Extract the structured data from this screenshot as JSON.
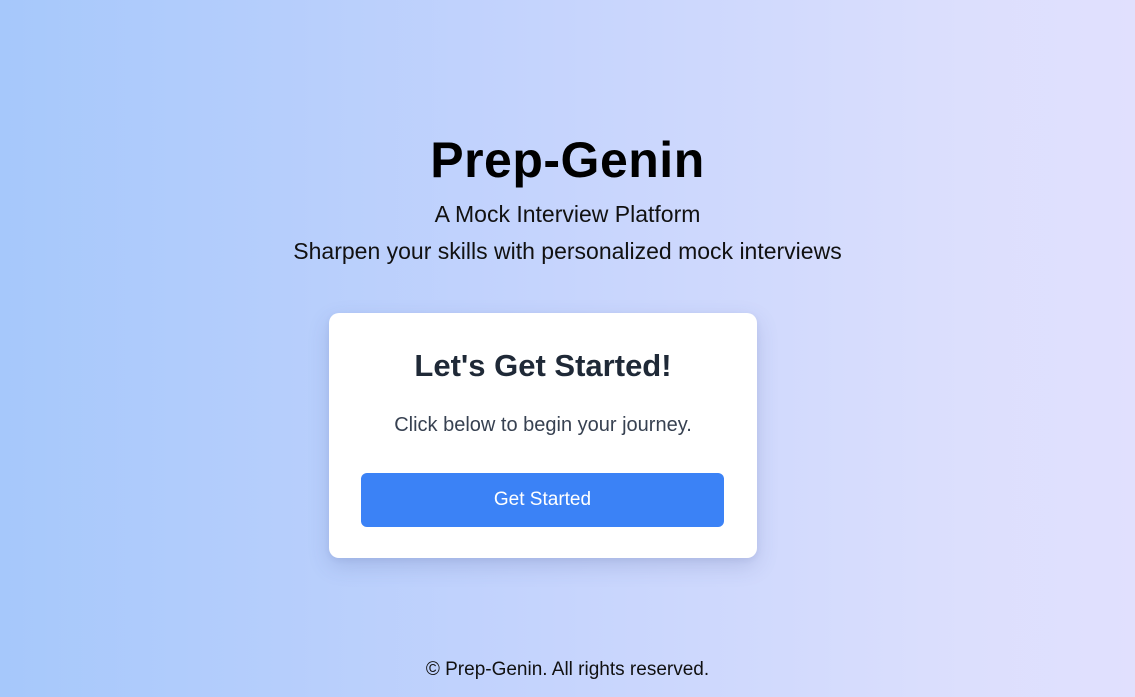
{
  "hero": {
    "title": "Prep-Genin",
    "tagline": "A Mock Interview Platform",
    "subtagline": "Sharpen your skills with personalized mock interviews"
  },
  "card": {
    "title": "Let's Get Started!",
    "text": "Click below to begin your journey.",
    "button_label": "Get Started"
  },
  "footer": {
    "text": "© Prep-Genin. All rights reserved."
  },
  "colors": {
    "background_start": "#a6c8fb",
    "background_end": "#e1e0fe",
    "card_background": "#ffffff",
    "button_background": "#3b82f6",
    "button_text": "#ffffff",
    "card_title": "#1f2937"
  }
}
